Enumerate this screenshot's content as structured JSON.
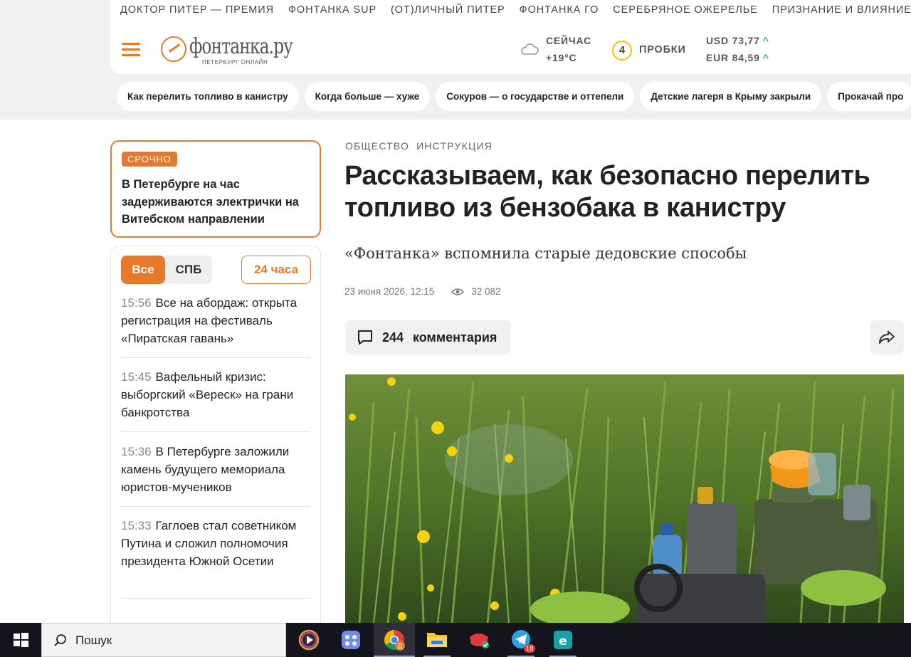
{
  "header": {
    "top_links": [
      "ДОКТОР ПИТЕР — ПРЕМИЯ",
      "ФОНТАНКА SUP",
      "(ОТ)ЛИЧНЫЙ ПИТЕР",
      "ФОНТАНКА ГО",
      "СЕРЕБРЯНОЕ ОЖЕРЕЛЬЕ",
      "ПРИЗНАНИЕ И ВЛИЯНИЕ"
    ],
    "logo": {
      "name": "фонтанка.ру",
      "tagline": "ПЕТЕРБУРГ ОНЛАЙН"
    },
    "weather": {
      "label": "СЕЙЧАС",
      "temp": "+19°С",
      "icon": "cloud-icon"
    },
    "traffic": {
      "score": "4",
      "label": "ПРОБКИ"
    },
    "currency": [
      {
        "text": "USD 73,77",
        "trend": "up"
      },
      {
        "text": "EUR 84,59",
        "trend": "up"
      }
    ],
    "chips": [
      "Как перелить топливо в канистру",
      "Когда больше — хуже",
      "Сокуров — о государстве и оттепели",
      "Детские лагеря в Крыму закрыли",
      "Прокачай про"
    ]
  },
  "urgent": {
    "badge": "СРОЧНО",
    "text": "В Петербурге на час задерживаются электрички на Витебском направлении"
  },
  "feed": {
    "tabs": [
      "Все",
      "СПБ"
    ],
    "period": "24 часа",
    "items": [
      {
        "time": "15:56",
        "text": "Все на абордаж: открыта регистрация на фестиваль «Пиратская гавань»"
      },
      {
        "time": "15:45",
        "text": "Вафельный кризис: выборгский «Вереск» на грани банкротства"
      },
      {
        "time": "15:36",
        "text": "В Петербурге заложили камень будущего мемориала юристов-мучеников"
      },
      {
        "time": "15:33",
        "text": "Гаглоев стал советником Путина и сложил полномочия президента Южной Осетии"
      }
    ]
  },
  "article": {
    "rubrics": [
      "ОБЩЕСТВО",
      "ИНСТРУКЦИЯ"
    ],
    "title": "Рассказываем, как безопасно перелить топливо из бензобака в канистру",
    "subtitle": "«Фонтанка» вспомнила старые дедовские способы",
    "date": "23 июня 2026, 12:15",
    "views": "32 082",
    "comments_count": "244",
    "comments_label": "комментария"
  },
  "taskbar": {
    "search_placeholder": "Пошук",
    "apps": [
      "media-player-icon",
      "app-icon",
      "chrome-icon",
      "file-explorer-icon",
      "anydesk-icon",
      "telegram-icon",
      "eset-icon"
    ],
    "telegram_badge": "18"
  },
  "colors": {
    "accent": "#e8782a",
    "traffic": "#f2c300",
    "up": "#3aa86c",
    "taskbar": "#14141c"
  }
}
